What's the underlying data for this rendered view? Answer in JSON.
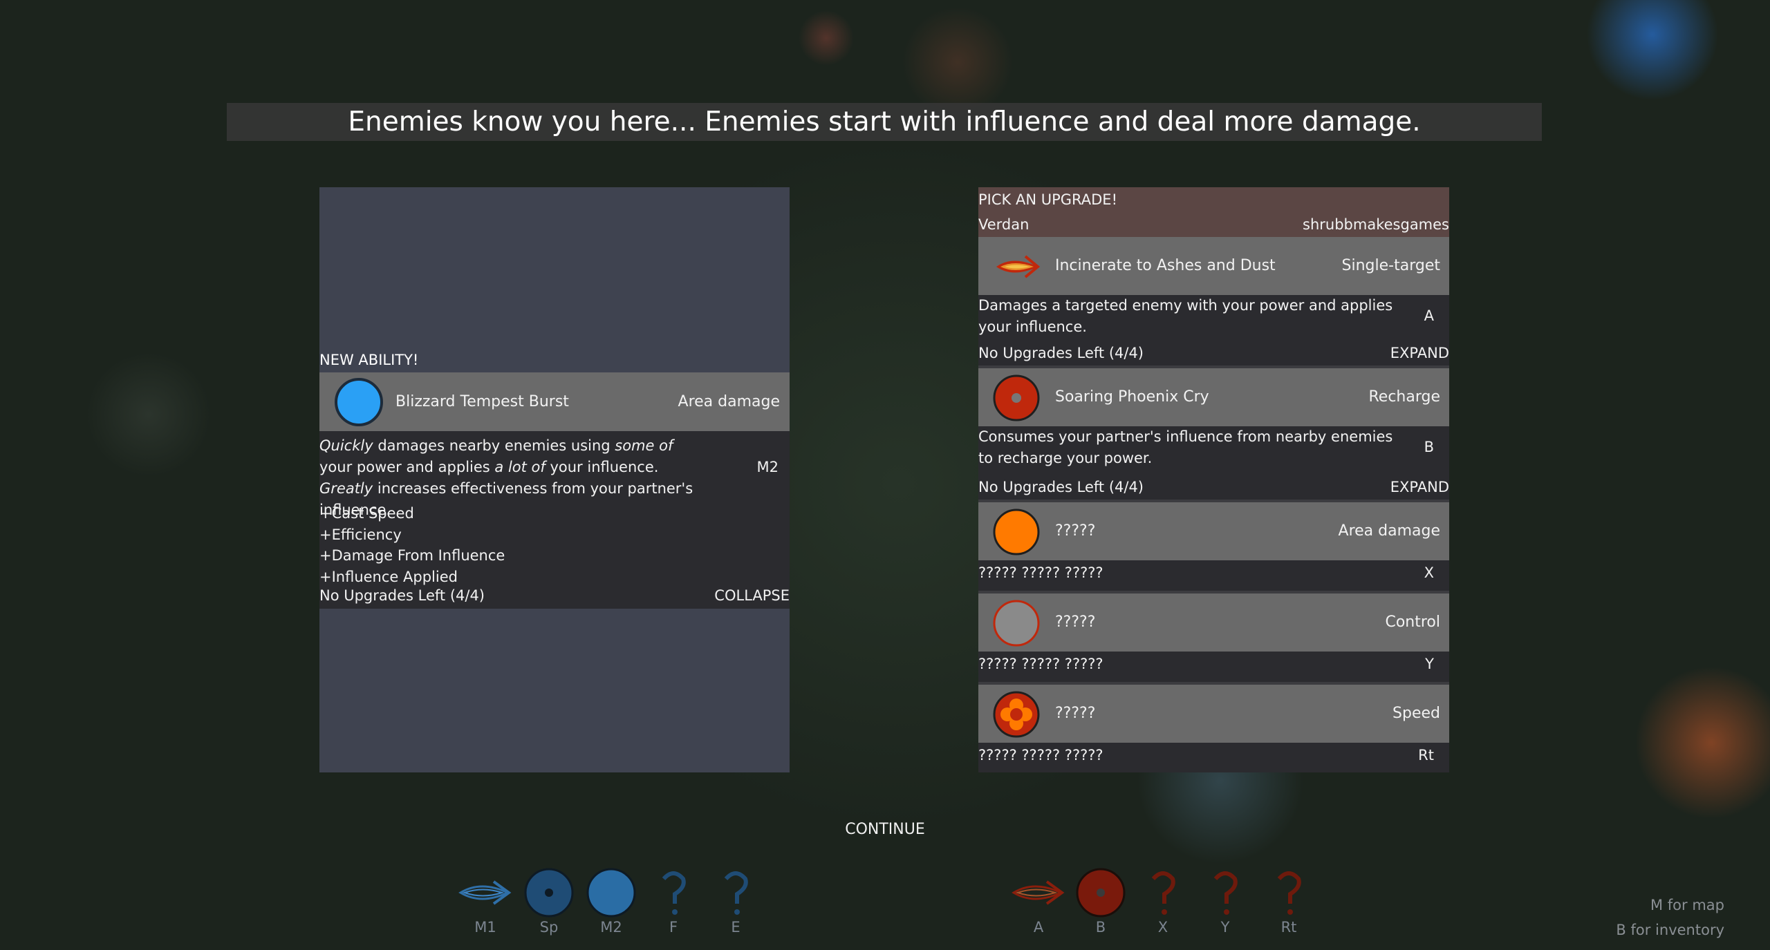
{
  "banner": "Enemies know you here... Enemies start with influence and deal more damage.",
  "left_panel": {
    "header": "NEW ABILITY!",
    "ability": {
      "name": "Blizzard Tempest Burst",
      "type": "Area damage",
      "icon": "blue-orb-icon",
      "color": "#2aa0f5"
    },
    "description": {
      "quickly": "Quickly",
      "p1": " damages nearby enemies using ",
      "some_of": "some of",
      "p2": " your power and applies ",
      "a_lot_of": "a lot of",
      "p3": " your influence. ",
      "greatly": "Greatly",
      "p4": " increases effectiveness from your partner's influence."
    },
    "key": "M2",
    "modifiers": [
      "+Cast Speed",
      "+Efficiency",
      "+Damage From Influence",
      "+Influence Applied"
    ],
    "footer_status": "No Upgrades Left (4/4)",
    "footer_action": "COLLAPSE"
  },
  "right_panel": {
    "title": "PICK AN UPGRADE!",
    "character": "Verdan",
    "author": "shrubbmakesgames",
    "upgrades": [
      {
        "name": "Incinerate to Ashes and Dust",
        "type": "Single-target",
        "icon": "fire-arrow-icon",
        "description": "Damages a targeted enemy with your power and applies your influence.",
        "key": "A",
        "status": "No Upgrades Left (4/4)",
        "action": "EXPAND"
      },
      {
        "name": "Soaring Phoenix Cry",
        "type": "Recharge",
        "icon": "red-target-orb-icon",
        "description": "Consumes your partner's influence from nearby enemies to recharge your power.",
        "key": "B",
        "status": "No Upgrades Left (4/4)",
        "action": "EXPAND"
      },
      {
        "name": "?????",
        "type": "Area damage",
        "icon": "orange-orb-icon",
        "description": "????? ????? ?????",
        "key": "X"
      },
      {
        "name": "?????",
        "type": "Control",
        "icon": "gray-orb-icon",
        "description": "????? ????? ?????",
        "key": "Y"
      },
      {
        "name": "?????",
        "type": "Speed",
        "icon": "flower-orb-icon",
        "description": "????? ????? ?????",
        "key": "Rt"
      }
    ]
  },
  "continue_label": "CONTINUE",
  "hotbar_left": [
    {
      "label": "M1",
      "icon": "blue-arrow-icon"
    },
    {
      "label": "Sp",
      "icon": "blue-target-orb-icon"
    },
    {
      "label": "M2",
      "icon": "blue-orb-icon"
    },
    {
      "label": "F",
      "icon": "question-mark-icon"
    },
    {
      "label": "E",
      "icon": "question-mark-icon"
    }
  ],
  "hotbar_right": [
    {
      "label": "A",
      "icon": "red-arrow-icon"
    },
    {
      "label": "B",
      "icon": "red-target-orb-icon"
    },
    {
      "label": "X",
      "icon": "question-mark-icon"
    },
    {
      "label": "Y",
      "icon": "question-mark-icon"
    },
    {
      "label": "Rt",
      "icon": "question-mark-icon"
    }
  ],
  "hints": {
    "map": "M for map",
    "inventory": "B for inventory"
  },
  "colors": {
    "player_blue": "#2aa0f5",
    "partner_red": "#c0280c",
    "orange": "#ff7a00"
  }
}
